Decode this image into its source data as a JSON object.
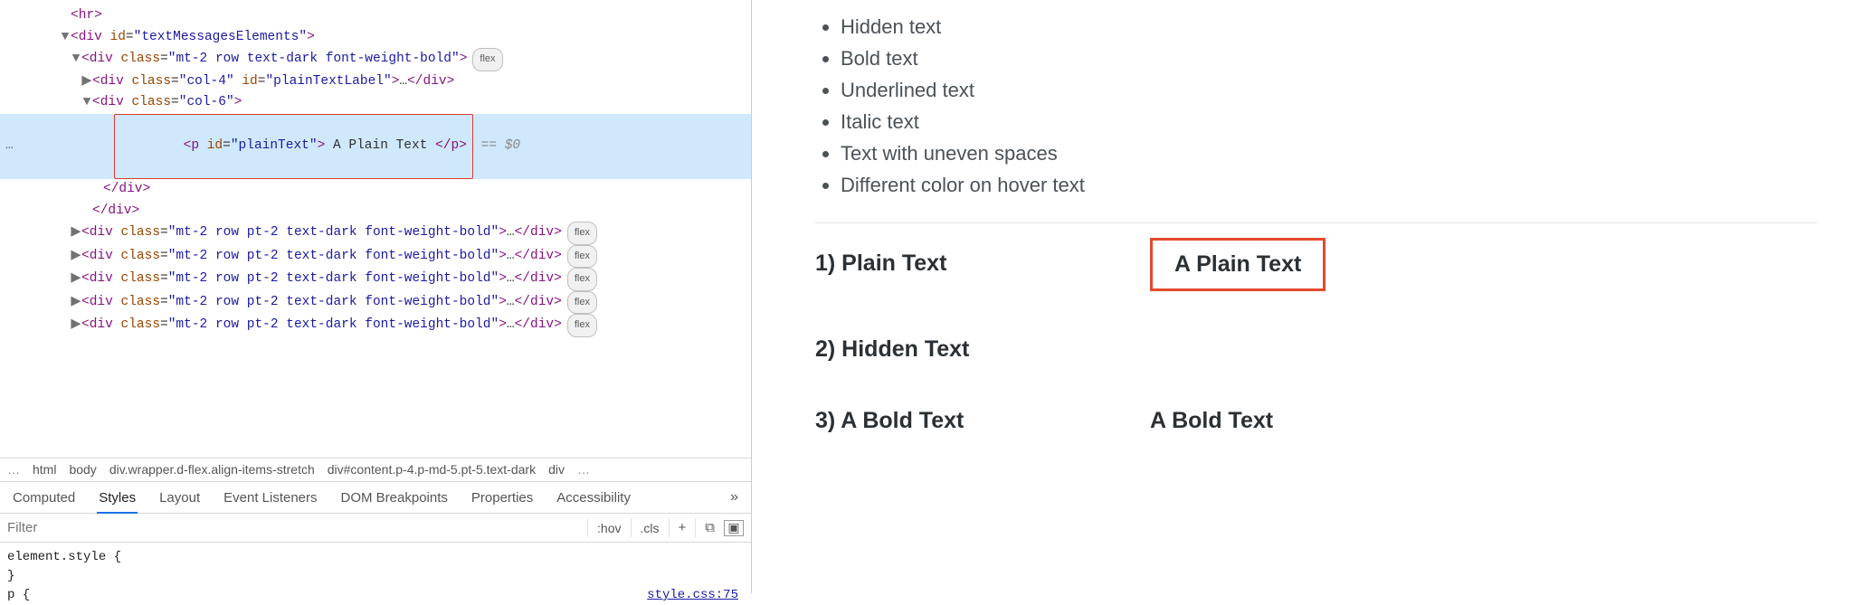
{
  "dom": {
    "row0": "<hr>",
    "row1": {
      "open": "<div",
      "attrs": [
        [
          "id",
          "textMessagesElements"
        ]
      ],
      "close": ">"
    },
    "row2": {
      "open": "<div",
      "attrs": [
        [
          "class",
          "mt-2 row text-dark font-weight-bold"
        ]
      ],
      "close": ">",
      "pill": "flex"
    },
    "row3": {
      "open": "<div",
      "attrs": [
        [
          "class",
          "col-4"
        ],
        [
          "id",
          "plainTextLabel"
        ]
      ],
      "ell": "…",
      "closeTag": "</div>"
    },
    "row4": {
      "open": "<div",
      "attrs": [
        [
          "class",
          "col-6"
        ]
      ],
      "close": ">"
    },
    "row5": {
      "open": "<p",
      "attrs": [
        [
          "id",
          "plainText"
        ]
      ],
      "text": " A Plain Text ",
      "closeTag": "</p>",
      "suffix": " == $0"
    },
    "row6": "</div>",
    "row7": "</div>",
    "rowRep": {
      "open": "<div",
      "attrs": [
        [
          "class",
          "mt-2 row pt-2 text-dark font-weight-bold"
        ]
      ],
      "ell": "…",
      "closeTag": "</div>",
      "pill": "flex"
    },
    "repeat": 5
  },
  "breadcrumb": {
    "left_more": "…",
    "items": [
      "html",
      "body",
      "div.wrapper.d-flex.align-items-stretch",
      "div#content.p-4.p-md-5.pt-5.text-dark",
      "div"
    ],
    "right_more": "…"
  },
  "tabs": {
    "items": [
      "Computed",
      "Styles",
      "Layout",
      "Event Listeners",
      "DOM Breakpoints",
      "Properties",
      "Accessibility"
    ],
    "active": 1,
    "more": "»"
  },
  "filter": {
    "placeholder": "Filter",
    "hov": ":hov",
    "cls": ".cls",
    "plus": "+"
  },
  "styles": {
    "line1": "element.style {",
    "line2": "}",
    "p_selector": "p {",
    "source": "style.css:75"
  },
  "page": {
    "list": [
      "Hidden text",
      "Bold text",
      "Underlined text",
      "Italic text",
      "Text with uneven spaces",
      "Different color on hover text"
    ],
    "blocks": [
      {
        "label": "1) Plain Text",
        "value": "A Plain Text",
        "outlined": true
      },
      {
        "label": "2) Hidden Text",
        "value": ""
      },
      {
        "label": "3) A Bold Text",
        "value": "A Bold Text"
      }
    ]
  }
}
